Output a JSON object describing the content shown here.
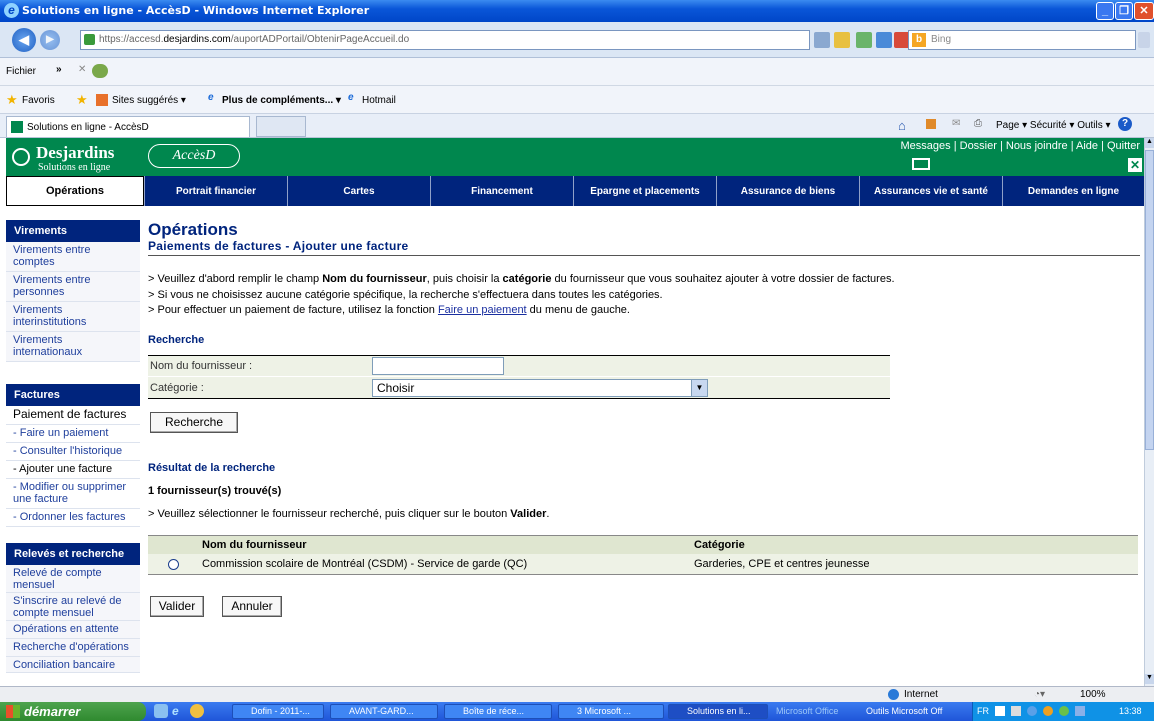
{
  "window": {
    "title": "Solutions en ligne - AccèsD - Windows Internet Explorer"
  },
  "addressbar": {
    "url_prefix": "https://accesd.",
    "url_domain": "desjardins.com",
    "url_path": "/auportADPortail/ObtenirPageAccueil.do",
    "search_placeholder": "Bing"
  },
  "menubar": {
    "fichier": "Fichier"
  },
  "favbar": {
    "favoris": "Favoris",
    "sites": "Sites suggérés ▾",
    "plus": "Plus de compléments... ▾",
    "hotmail": "Hotmail"
  },
  "tabbar": {
    "tab_title": "Solutions en ligne - AccèsD",
    "tools": "Page ▾   Sécurité ▾   Outils ▾"
  },
  "site": {
    "brand": "Desjardins",
    "brand_sub": "Solutions en ligne",
    "acces": "AccèsD",
    "toplinks": "Messages | Dossier | Nous joindre | Aide | Quitter"
  },
  "nav": {
    "tabs": [
      "Opérations",
      "Portrait financier",
      "Cartes",
      "Financement",
      "Epargne et placements",
      "Assurance de biens",
      "Assurances vie et santé",
      "Demandes en ligne"
    ]
  },
  "sidebar": {
    "virements_head": "Virements",
    "virements": [
      "Virements entre comptes",
      "Virements entre personnes",
      "Virements interinstitutions",
      "Virements internationaux"
    ],
    "factures_head": "Factures",
    "paiement": "Paiement de factures",
    "factures": [
      "- Faire un paiement",
      "- Consulter l'historique",
      "- Ajouter une facture",
      "- Modifier ou supprimer une facture",
      "- Ordonner les factures"
    ],
    "releves_head": "Relevés et recherche",
    "releves": [
      "Relevé de compte mensuel",
      "S'inscrire au relevé de compte mensuel",
      "Opérations en attente",
      "Recherche d'opérations",
      "Conciliation bancaire"
    ]
  },
  "main": {
    "title": "Opérations",
    "subtitle": "Paiements de factures - Ajouter une facture",
    "instr1_a": "> Veuillez d'abord remplir le champ ",
    "instr1_b": "Nom du fournisseur",
    "instr1_c": ", puis choisir la ",
    "instr1_d": "catégorie",
    "instr1_e": " du fournisseur que vous souhaitez ajouter à votre dossier de factures.",
    "instr2": "> Si vous ne choisissez aucune catégorie spécifique, la recherche s'effectuera dans toutes les catégories.",
    "instr3_a": "> Pour effectuer un paiement de facture, utilisez la fonction ",
    "instr3_link": "Faire un paiement",
    "instr3_b": " du menu de gauche.",
    "recherche_title": "Recherche",
    "nom_label": "Nom du fournisseur :",
    "nom_value": "",
    "cat_label": "Catégorie :",
    "cat_value": "Choisir",
    "recherche_btn": "Recherche",
    "resultat_title": "Résultat de la recherche",
    "count": "1 fournisseur(s) trouvé(s)",
    "instr4_a": "> Veuillez sélectionner le fournisseur recherché, puis cliquer sur le bouton ",
    "instr4_b": "Valider",
    "instr4_c": ".",
    "col_nom": "Nom du fournisseur",
    "col_cat": "Catégorie",
    "rows": [
      {
        "nom": "Commission scolaire de Montréal (CSDM) - Service de garde (QC)",
        "cat": "Garderies, CPE et centres jeunesse"
      }
    ],
    "valider_btn": "Valider",
    "annuler_btn": "Annuler"
  },
  "statusbar": {
    "zone": "Internet",
    "zoom": "100%"
  },
  "taskbar": {
    "start": "démarrer",
    "tasks": [
      "Dofin - 2011-...",
      "AVANT-GARD...",
      "Boîte de réce...",
      "3 Microsoft ...",
      "Solutions en li...",
      "Microsoft Office",
      "Outils Microsoft Off"
    ],
    "lang": "FR",
    "clock": "13:38"
  }
}
